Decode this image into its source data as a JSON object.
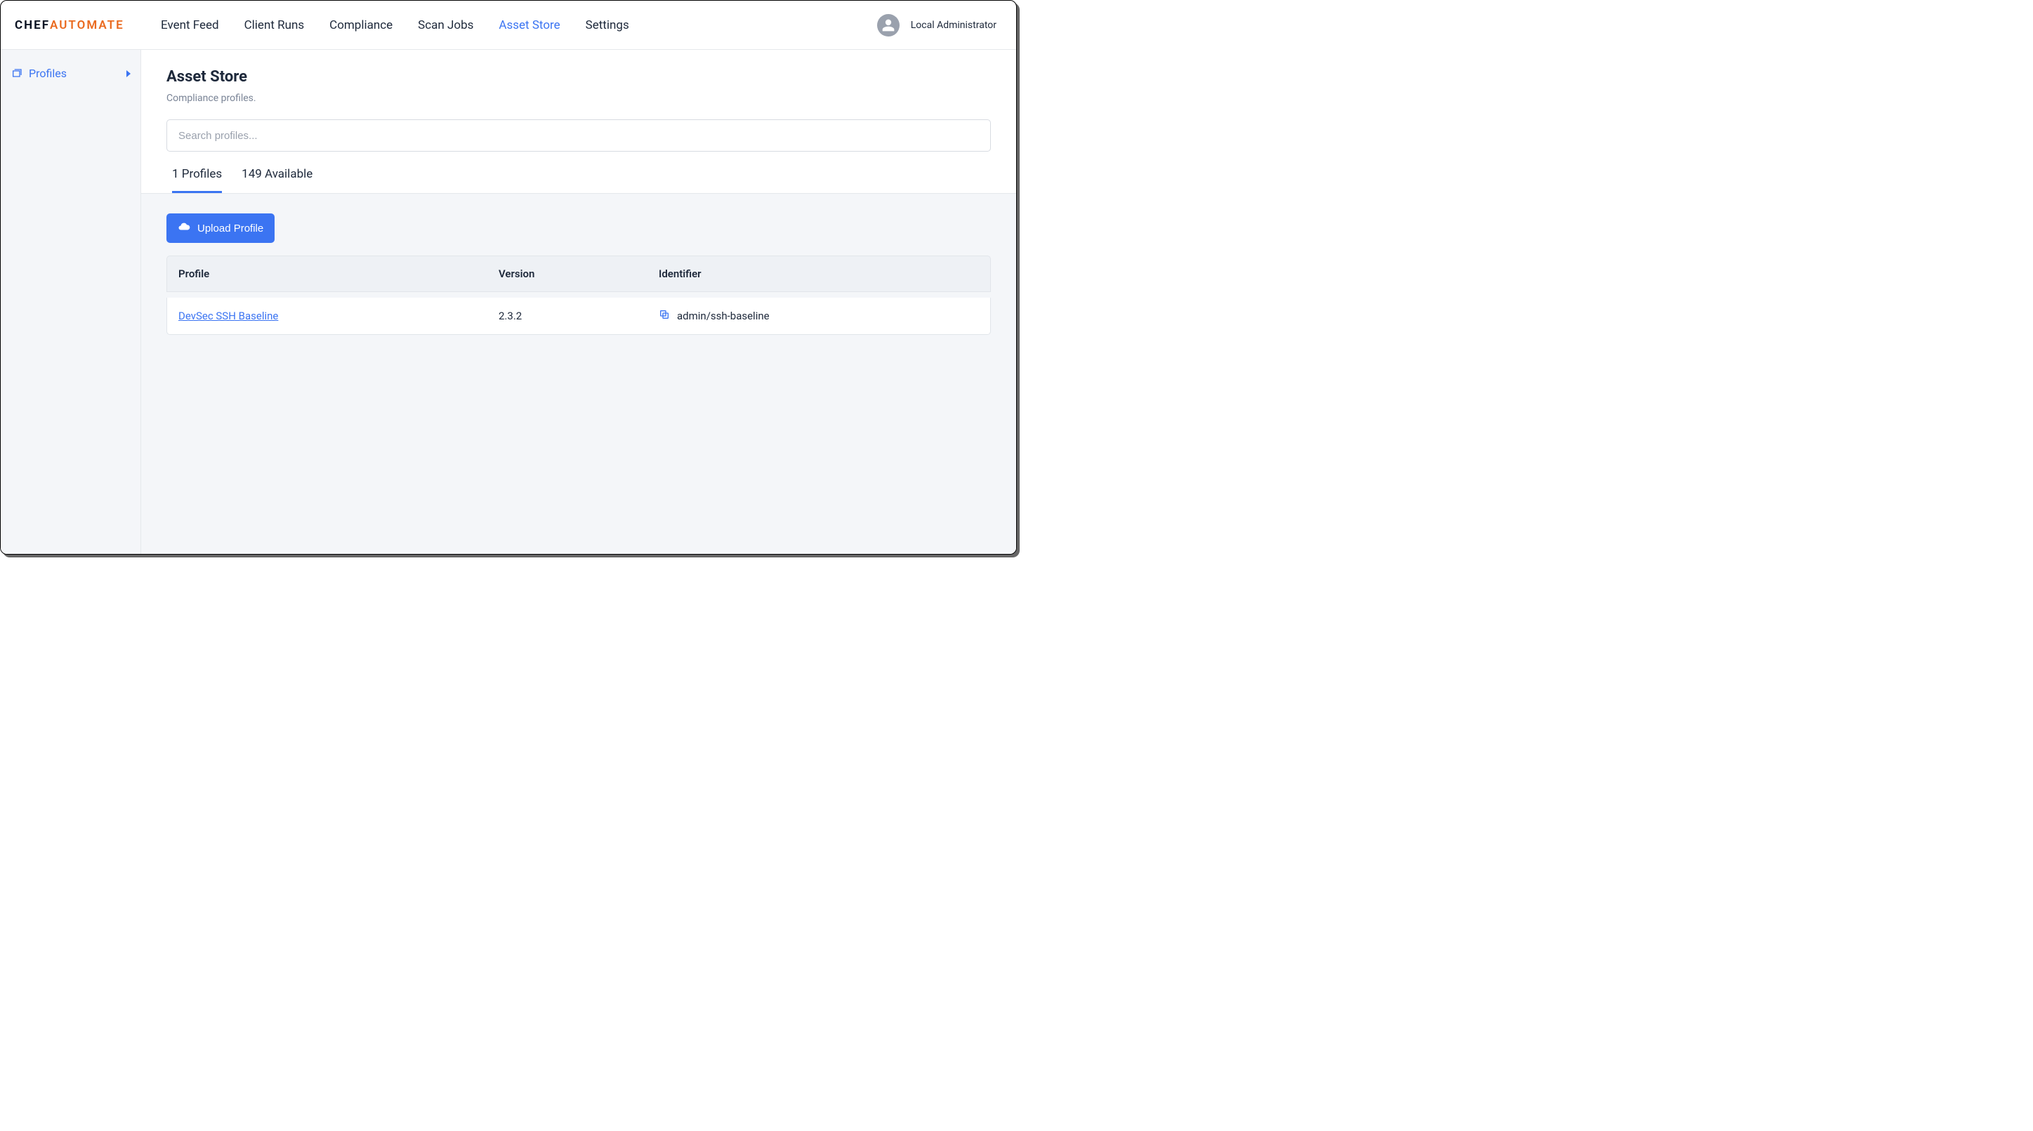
{
  "brand": {
    "left": "CHEF",
    "right": "AUTOMATE"
  },
  "nav": {
    "items": [
      {
        "label": "Event Feed",
        "active": false
      },
      {
        "label": "Client Runs",
        "active": false
      },
      {
        "label": "Compliance",
        "active": false
      },
      {
        "label": "Scan Jobs",
        "active": false
      },
      {
        "label": "Asset Store",
        "active": true
      },
      {
        "label": "Settings",
        "active": false
      }
    ]
  },
  "user": {
    "name": "Local Administrator"
  },
  "sidebar": {
    "items": [
      {
        "label": "Profiles"
      }
    ]
  },
  "page": {
    "title": "Asset Store",
    "subtitle": "Compliance profiles."
  },
  "search": {
    "placeholder": "Search profiles...",
    "value": ""
  },
  "tabs": [
    {
      "label": "1 Profiles",
      "active": true
    },
    {
      "label": "149 Available",
      "active": false
    }
  ],
  "upload": {
    "label": "Upload Profile"
  },
  "table": {
    "headers": {
      "profile": "Profile",
      "version": "Version",
      "identifier": "Identifier"
    },
    "rows": [
      {
        "profile": "DevSec SSH Baseline",
        "version": "2.3.2",
        "identifier": "admin/ssh-baseline"
      }
    ]
  }
}
